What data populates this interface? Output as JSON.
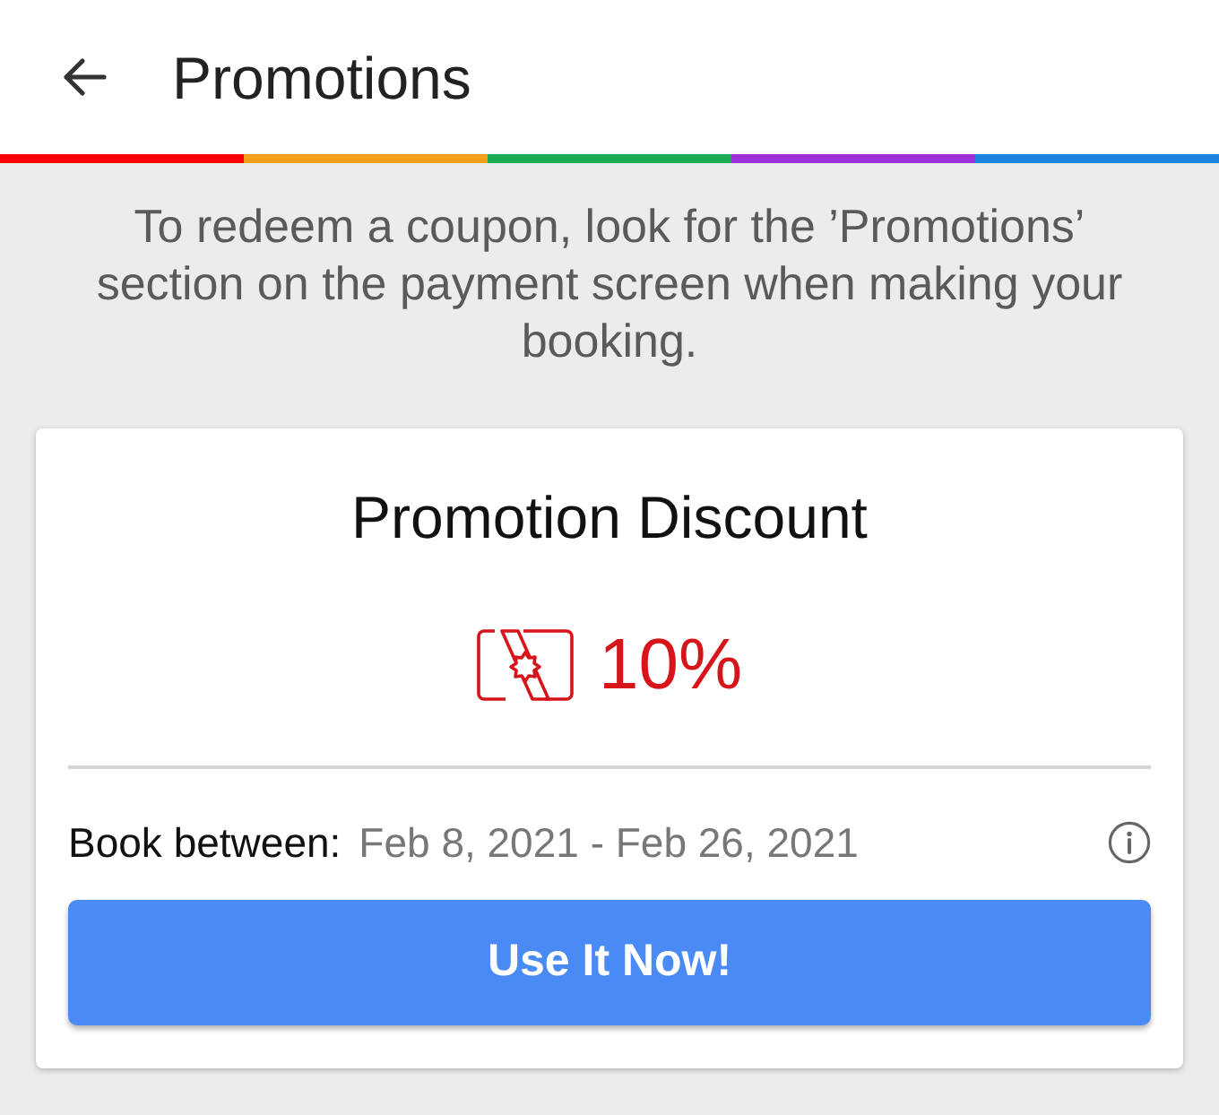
{
  "header": {
    "title": "Promotions",
    "color_bar": [
      {
        "color": "#ff0000"
      },
      {
        "color": "#f5a01a"
      },
      {
        "color": "#1aaa55"
      },
      {
        "color": "#9b30d9"
      },
      {
        "color": "#1a84e0"
      }
    ]
  },
  "intro": "To redeem a coupon, look for the ’Promotions’ section on the payment screen when making your booking.",
  "promotion": {
    "title": "Promotion Discount",
    "discount": "10%",
    "book_label": "Book between:",
    "book_dates": "Feb 8, 2021 - Feb 26, 2021",
    "button": "Use It Now!"
  }
}
